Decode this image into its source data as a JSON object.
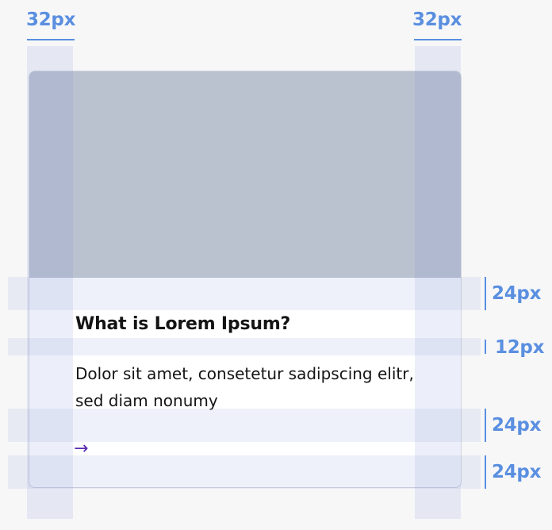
{
  "card": {
    "title": "What is Lorem Ipsum?",
    "body": "Dolor sit amet, consetetur sadipscing elitr, sed diam nonumy",
    "arrow": "→"
  },
  "annotations": {
    "left_padding": "32px",
    "right_padding": "32px",
    "top_padding": "24px",
    "title_gap": "12px",
    "text_gap": "24px",
    "bottom_padding": "24px"
  },
  "colors": {
    "accent": "#5a8fe0",
    "image_placeholder": "#bac1cf",
    "arrow": "#5b2bb3"
  }
}
